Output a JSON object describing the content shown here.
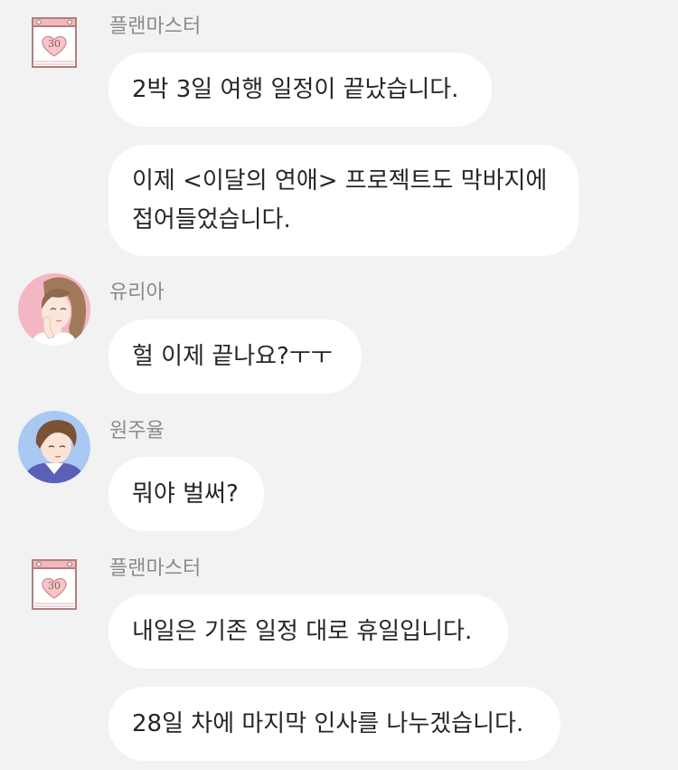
{
  "messages": [
    {
      "sender": "플랜마스터",
      "bubbles": [
        "2박 3일 여행 일정이 끝났습니다.",
        "이제 <이달의 연애> 프로젝트도 막바지에 접어들었습니다."
      ]
    },
    {
      "sender": "유리아",
      "bubbles": [
        "헐 이제 끝나요?ㅜㅜ"
      ]
    },
    {
      "sender": "원주율",
      "bubbles": [
        "뭐야 벌써?"
      ]
    },
    {
      "sender": "플랜마스터",
      "bubbles": [
        "내일은 기존 일정 대로 휴일입니다.",
        "28일 차에 마지막 인사를 나누겠습니다."
      ]
    }
  ],
  "calendar_icon_number": "30",
  "colors": {
    "background": "#f2f2f2",
    "bubble": "#ffffff",
    "text": "#262626",
    "sender": "#8a8a8a",
    "calendar_accent": "#e8a3a8"
  }
}
